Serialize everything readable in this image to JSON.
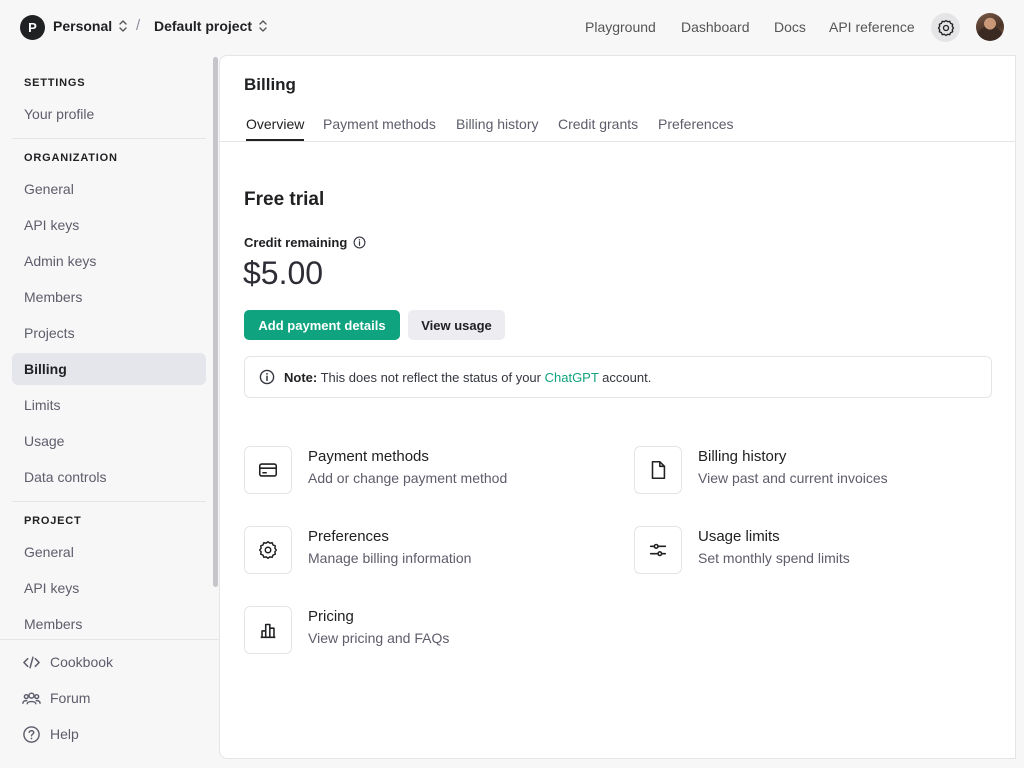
{
  "header": {
    "org_initial": "P",
    "org_name": "Personal",
    "separator": "/",
    "project_name": "Default project",
    "nav": [
      "Playground",
      "Dashboard",
      "Docs",
      "API reference"
    ]
  },
  "sidebar": {
    "settings_heading": "SETTINGS",
    "profile": "Your profile",
    "org_heading": "ORGANIZATION",
    "org_items": [
      "General",
      "API keys",
      "Admin keys",
      "Members",
      "Projects",
      "Billing",
      "Limits",
      "Usage",
      "Data controls"
    ],
    "active_item": "Billing",
    "project_heading": "PROJECT",
    "project_items": [
      "General",
      "API keys",
      "Members"
    ],
    "links": {
      "cookbook": "Cookbook",
      "forum": "Forum",
      "help": "Help"
    }
  },
  "main": {
    "title": "Billing",
    "tabs": [
      "Overview",
      "Payment methods",
      "Billing history",
      "Credit grants",
      "Preferences"
    ],
    "active_tab": "Overview",
    "plan": "Free trial",
    "credit_label": "Credit remaining",
    "credit_amount": "$5.00",
    "add_payment_button": "Add payment details",
    "view_usage_button": "View usage",
    "note": {
      "bold": "Note:",
      "text_before": " This does not reflect the status of your ",
      "link": "ChatGPT",
      "text_after": " account."
    },
    "cards": {
      "payment": {
        "title": "Payment methods",
        "desc": "Add or change payment method"
      },
      "history": {
        "title": "Billing history",
        "desc": "View past and current invoices"
      },
      "preferences": {
        "title": "Preferences",
        "desc": "Manage billing information"
      },
      "limits": {
        "title": "Usage limits",
        "desc": "Set monthly spend limits"
      },
      "pricing": {
        "title": "Pricing",
        "desc": "View pricing and FAQs"
      }
    }
  },
  "colors": {
    "accent": "#10a37f",
    "active_bg": "#e5e5ec",
    "background": "#f7f7f8"
  },
  "icons": [
    "chevron-updown-icon",
    "gear-icon",
    "code-icon",
    "users-icon",
    "help-icon",
    "info-icon",
    "credit-card-icon",
    "file-icon",
    "sliders-icon",
    "bar-chart-icon"
  ]
}
